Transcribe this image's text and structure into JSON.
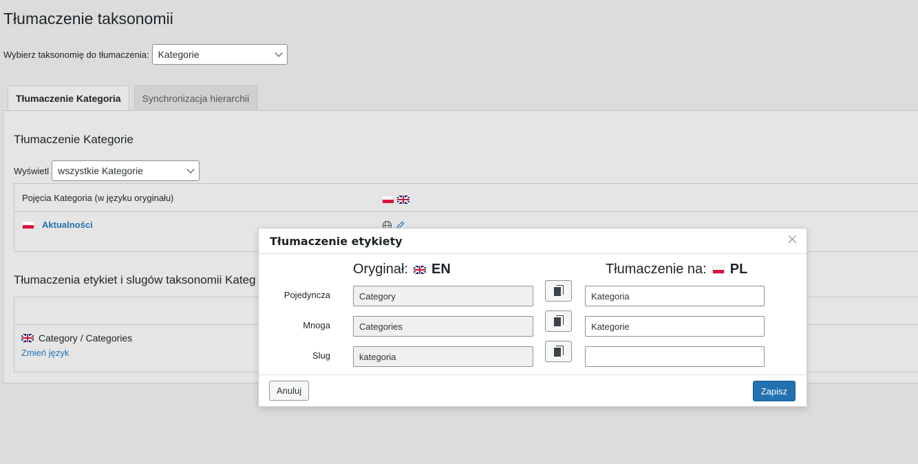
{
  "page": {
    "title": "Tłumaczenie taksonomii",
    "taxonomy_select_label": "Wybierz taksonomię do tłumaczenia:",
    "taxonomy_select_value": "Kategorie"
  },
  "tabs": [
    {
      "label": "Tłumaczenie Kategoria",
      "active": true
    },
    {
      "label": "Synchronizacja hierarchii",
      "active": false
    }
  ],
  "terms_section": {
    "heading": "Tłumaczenie Kategorie",
    "show_label": "Wyświetl",
    "show_value": "wszystkie Kategorie",
    "column_header": "Pojęcia Kategoria (w języku oryginału)",
    "rows": [
      {
        "flag": "pl",
        "name": "Aktualności"
      }
    ]
  },
  "labels_section": {
    "heading": "Tłumaczenia etykiet i slugów taksonomii Kateg",
    "row_flag": "gb",
    "row_text": "Category / Categories",
    "change_language_link": "Zmień język"
  },
  "dialog": {
    "title": "Tłumaczenie etykiety",
    "original_label": "Oryginał:",
    "original_lang": "EN",
    "translation_label": "Tłumaczenie na:",
    "translation_lang": "PL",
    "fields": [
      {
        "label": "Pojedyncza",
        "original": "Category",
        "translation": "Kategoria"
      },
      {
        "label": "Mnoga",
        "original": "Categories",
        "translation": "Kategorie"
      },
      {
        "label": "Slug",
        "original": "kategoria",
        "translation": ""
      }
    ],
    "cancel_label": "Anuluj",
    "save_label": "Zapisz"
  },
  "colors": {
    "accent": "#2271b1",
    "background": "#dcdcdc",
    "panel": "#e5e5e5"
  }
}
